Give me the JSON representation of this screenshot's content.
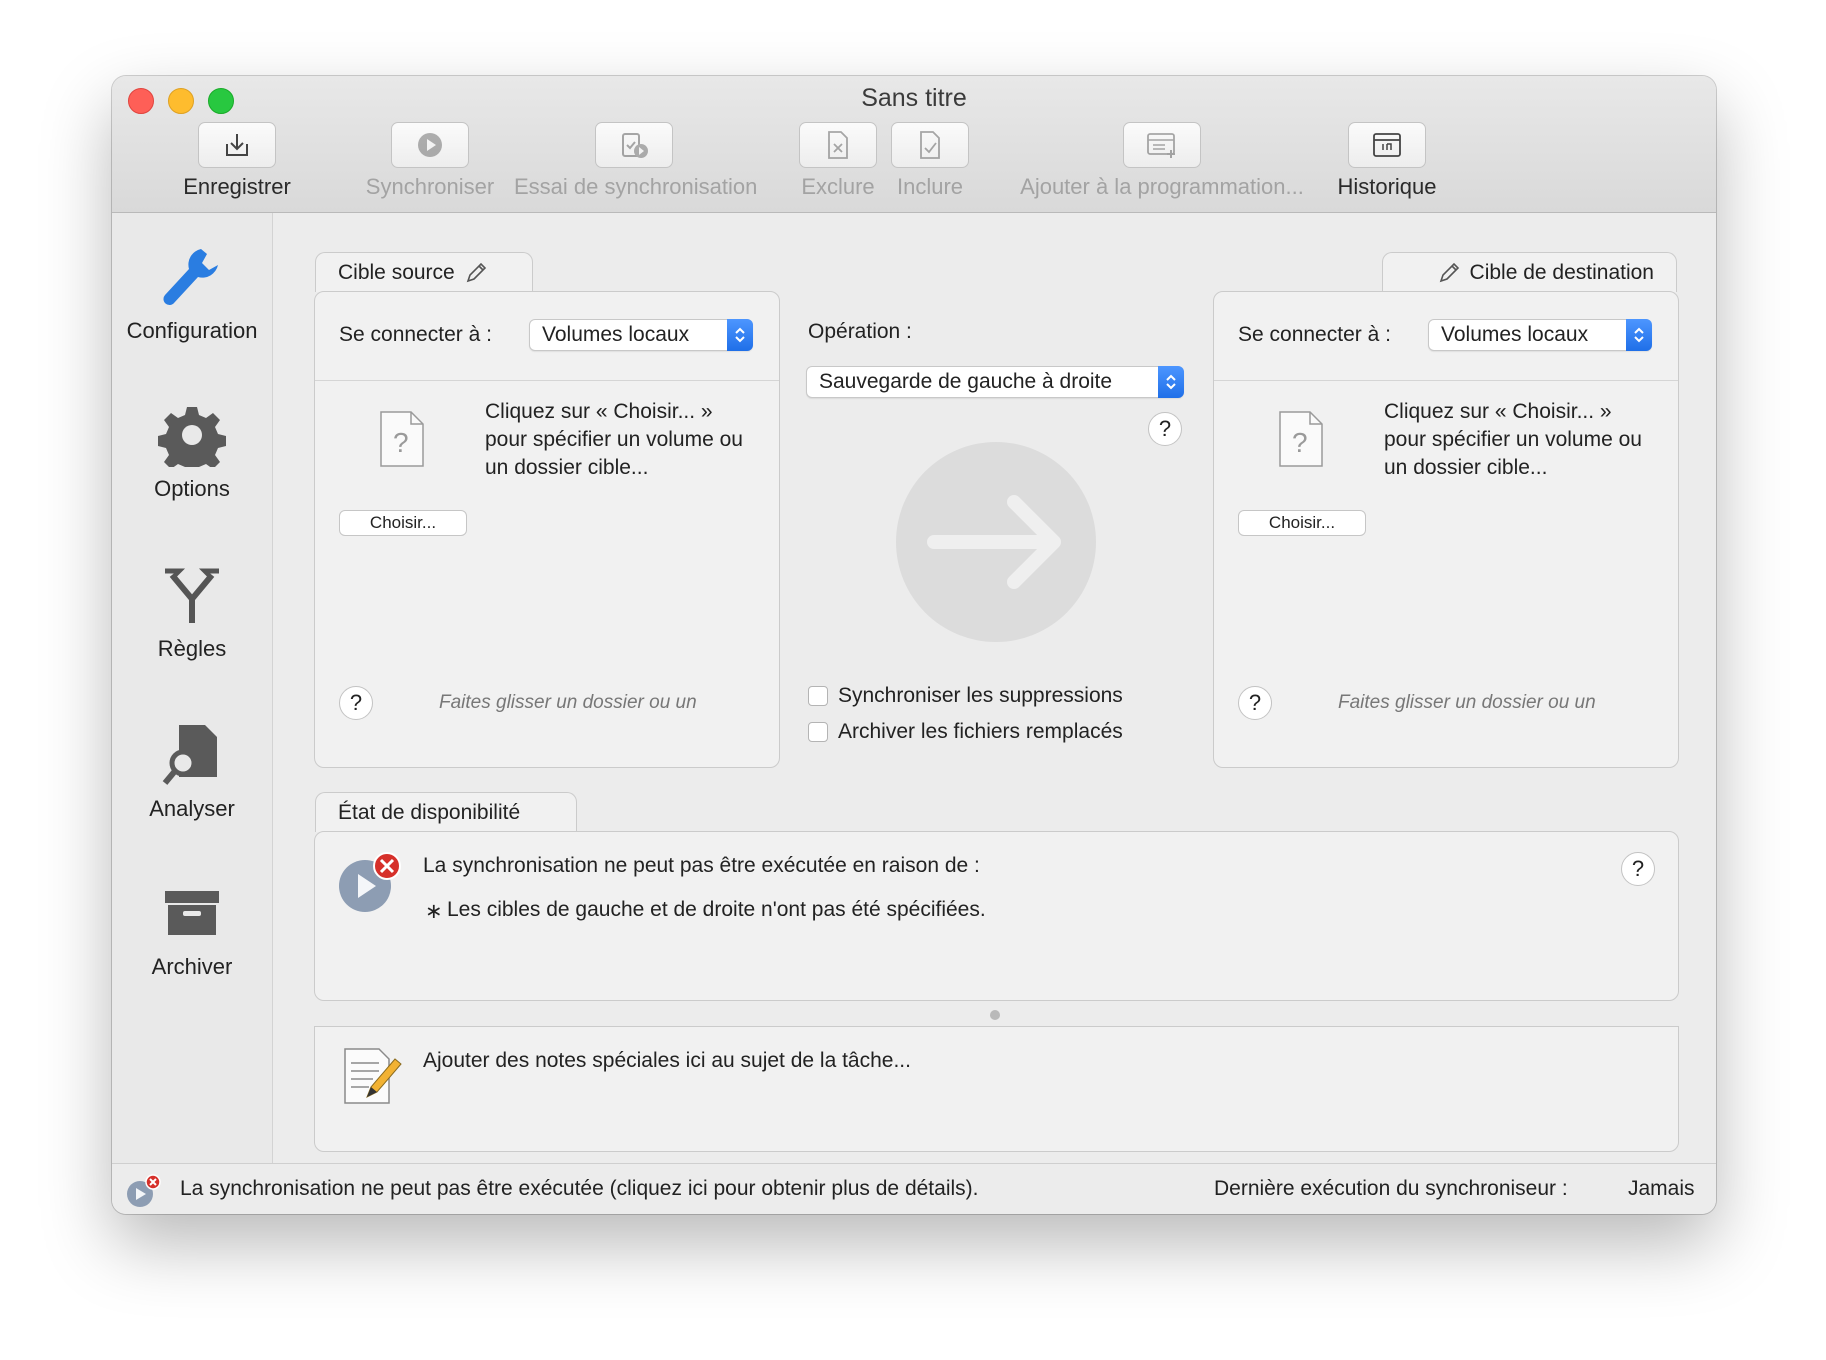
{
  "window": {
    "title": "Sans titre"
  },
  "toolbar": {
    "save": "Enregistrer",
    "sync": "Synchroniser",
    "trial": "Essai de synchronisation",
    "exclude": "Exclure",
    "include": "Inclure",
    "schedule": "Ajouter à la programmation...",
    "history": "Historique"
  },
  "sidebar": {
    "items": [
      {
        "label": "Configuration",
        "icon": "wrench-icon"
      },
      {
        "label": "Options",
        "icon": "gear-icon"
      },
      {
        "label": "Règles",
        "icon": "fork-icon"
      },
      {
        "label": "Analyser",
        "icon": "analyze-icon"
      },
      {
        "label": "Archiver",
        "icon": "archive-box-icon"
      }
    ]
  },
  "source": {
    "tab": "Cible source",
    "connect_label": "Se connecter à :",
    "connect_value": "Volumes locaux",
    "description": "Cliquez sur « Choisir... » pour spécifier un volume ou un dossier cible...",
    "choose": "Choisir...",
    "hint": "Faites glisser un dossier ou un",
    "help": "?"
  },
  "destination": {
    "tab": "Cible de destination",
    "connect_label": "Se connecter à :",
    "connect_value": "Volumes locaux",
    "description": "Cliquez sur « Choisir... » pour spécifier un volume ou un dossier cible...",
    "choose": "Choisir...",
    "hint": "Faites glisser un dossier ou un",
    "help": "?"
  },
  "operation": {
    "label": "Opération :",
    "value": "Sauvegarde de gauche à droite",
    "help": "?",
    "checkbox_deletions": "Synchroniser les suppressions",
    "checkbox_archive": "Archiver les fichiers remplacés"
  },
  "availability": {
    "tab": "État de disponibilité",
    "message": "La synchronisation ne peut pas être exécutée en raison de :",
    "bullet": "∗",
    "reason": "Les cibles de gauche et de droite n'ont pas été spécifiées.",
    "help": "?"
  },
  "notes": {
    "text": "Ajouter des notes spéciales ici au sujet de la tâche..."
  },
  "status": {
    "message": "La synchronisation ne peut pas être exécutée (cliquez ici pour obtenir plus de détails).",
    "last_run_label": "Dernière exécution du synchroniseur :",
    "last_run_value": "Jamais"
  },
  "colors": {
    "accent": "#1f6fe8",
    "wrench": "#2a7de1",
    "error": "#d6302a"
  }
}
